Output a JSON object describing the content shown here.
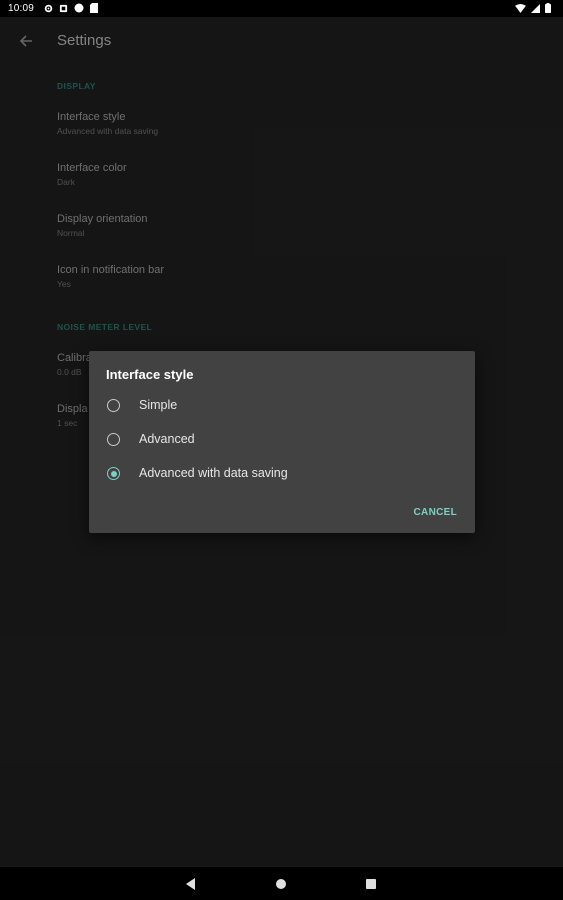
{
  "status_bar": {
    "time": "10:09",
    "icons_left": [
      "gear-icon",
      "notification-square-icon",
      "circle-icon",
      "sd-card-icon"
    ],
    "icons_right": [
      "wifi-icon",
      "signal-icon",
      "battery-icon"
    ]
  },
  "toolbar": {
    "title": "Settings",
    "back_icon": "arrow-back-icon"
  },
  "sections": {
    "display": {
      "header": "DISPLAY",
      "items": [
        {
          "title": "Interface style",
          "summary": "Advanced with data saving"
        },
        {
          "title": "Interface color",
          "summary": "Dark"
        },
        {
          "title": "Display orientation",
          "summary": "Normal"
        },
        {
          "title": "Icon in notification bar",
          "summary": "Yes"
        }
      ]
    },
    "noise": {
      "header": "NOISE METER LEVEL",
      "items": [
        {
          "title": "Calibra",
          "summary": "0.0 dB"
        },
        {
          "title": "Displa",
          "summary": "1 sec"
        }
      ]
    }
  },
  "dialog": {
    "title": "Interface style",
    "options": [
      {
        "label": "Simple",
        "selected": false
      },
      {
        "label": "Advanced",
        "selected": false
      },
      {
        "label": "Advanced with data saving",
        "selected": true
      }
    ],
    "cancel_label": "CANCEL"
  },
  "nav_bar": {
    "back_icon": "nav-back-icon",
    "home_icon": "nav-home-icon",
    "recents_icon": "nav-recents-icon"
  },
  "colors": {
    "accent": "#7ad2c2",
    "section_header": "#2e7f74",
    "background": "#212121",
    "dialog_background": "#424242"
  }
}
